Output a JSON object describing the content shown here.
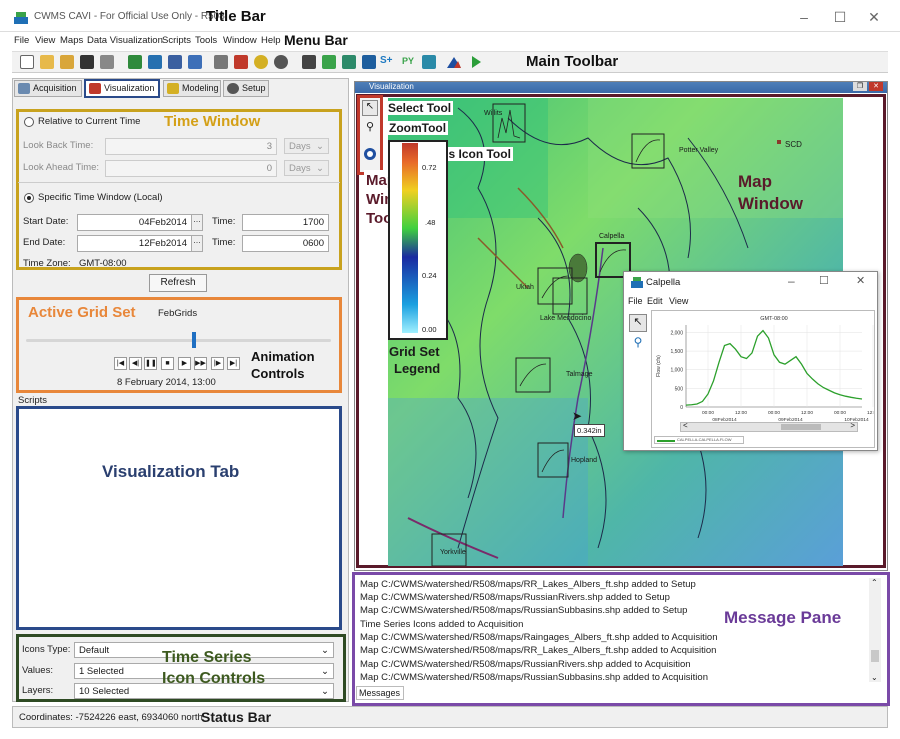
{
  "window": {
    "title": "CWMS CAVI - For Official Use Only - R508",
    "annotation": "Title Bar"
  },
  "menu": {
    "items": [
      "File",
      "View",
      "Maps",
      "Data Visualization",
      "Scripts",
      "Tools",
      "Window",
      "Help"
    ],
    "annotation": "Menu Bar"
  },
  "toolbar": {
    "annotation": "Main Toolbar",
    "icons": [
      "new-icon",
      "open-icon",
      "open-folder-icon",
      "save-icon",
      "print-icon",
      "grid-icon",
      "refresh-icon",
      "window-icon",
      "windows-icon",
      "tools-icon",
      "chart-icon",
      "gear-sun-icon",
      "gear-icon",
      "table-icon",
      "image-icon",
      "map-icon",
      "layers-icon",
      "script-s-icon",
      "python-icon",
      "database-icon",
      "triangle-chart-icon",
      "run-icon"
    ],
    "py_label": "PY",
    "s_label": "S+"
  },
  "tabs": {
    "acquisition": "Acquisition",
    "visualization": "Visualization",
    "modeling": "Modeling",
    "setup": "Setup"
  },
  "time_window": {
    "annotation": "Time Window",
    "relative_label": "Relative to Current Time",
    "look_back_label": "Look Back Time:",
    "look_back_value": "3",
    "look_back_unit": "Days",
    "look_ahead_label": "Look Ahead Time:",
    "look_ahead_value": "0",
    "look_ahead_unit": "Days",
    "specific_label": "Specific Time Window (Local)",
    "start_label": "Start Date:",
    "start_value": "04Feb2014",
    "start_time_label": "Time:",
    "start_time": "1700",
    "end_label": "End Date:",
    "end_value": "12Feb2014",
    "end_time_label": "Time:",
    "end_time": "0600",
    "timezone_label": "Time Zone:",
    "timezone_value": "GMT-08:00",
    "refresh": "Refresh"
  },
  "grid_set": {
    "annotation": "Active Grid Set",
    "name": "FebGrids",
    "animation_annotation_1": "Animation",
    "animation_annotation_2": "Controls",
    "current_time": "8 February 2014, 13:00",
    "slider_position": 0.55
  },
  "scripts": {
    "label": "Scripts",
    "annotation": "Visualization Tab"
  },
  "icon_controls": {
    "annotation_1": "Time Series",
    "annotation_2": "Icon Controls",
    "icons_type_label": "Icons Type:",
    "icons_type_value": "Default",
    "values_label": "Values:",
    "values_value": "1 Selected",
    "layers_label": "Layers:",
    "layers_value": "10 Selected"
  },
  "map": {
    "window_title": "Visualization",
    "annotation_1": "Map",
    "annotation_2": "Window",
    "toolbar_annotation_1": "Map",
    "toolbar_annotation_2": "Window",
    "toolbar_annotation_3": "Toolbar",
    "select_tool": "Select Tool",
    "zoom_tool": "ZoomTool",
    "ts_icon_tool": "Time Series Icon Tool",
    "legend_annotation_1": "Grid Set",
    "legend_annotation_2": "Legend",
    "legend_ticks": [
      "0.72",
      ".48",
      "0.24",
      "0.00"
    ],
    "places": [
      "Willits",
      "Potter Valley",
      "SCD",
      "Calpella",
      "Ukiah",
      "Lake Mendocino",
      "Talmage",
      "Hopland",
      "Yorkville"
    ],
    "measure_label": "0.342in"
  },
  "popup": {
    "title": "Calpella",
    "menu": [
      "File",
      "Edit",
      "View"
    ],
    "chart_header": "GMT-08:00",
    "legend_text": "CALPELLA-CALPELLA.FLOW"
  },
  "chart_data": {
    "type": "line",
    "title": "GMT-08:00",
    "xlabel": "",
    "ylabel": "Flow (cfs)",
    "x_ticks": [
      "00:00",
      "12:00",
      "00:00",
      "12:00",
      "00:00",
      "12:00"
    ],
    "x_date_ticks": [
      "08Feb2014",
      "09Feb2014",
      "10Feb2014"
    ],
    "y_ticks": [
      "0",
      "500",
      "1,000",
      "1,500",
      "2,000"
    ],
    "ylim": [
      0,
      2200
    ],
    "series": [
      {
        "name": "CALPELLA-CALPELLA.FLOW",
        "color": "#2ca02c",
        "x": [
          0,
          2,
          4,
          6,
          8,
          10,
          12,
          14,
          16,
          18,
          20,
          22,
          24,
          26,
          28,
          30,
          32,
          34,
          36,
          38,
          40,
          42,
          44,
          46,
          48,
          50,
          52,
          54,
          56,
          58,
          60,
          62,
          64
        ],
        "values": [
          50,
          60,
          80,
          150,
          350,
          700,
          1200,
          1650,
          1700,
          1550,
          1350,
          1300,
          1450,
          1900,
          2050,
          1850,
          1400,
          1200,
          1150,
          1250,
          1350,
          1150,
          900,
          750,
          620,
          520,
          450,
          380,
          330,
          290,
          260,
          235,
          215
        ]
      }
    ]
  },
  "messages": {
    "annotation": "Message Pane",
    "tab": "Messages",
    "lines": [
      "Map C:/CWMS/watershed/R508/maps/RR_Lakes_Albers_ft.shp added to Setup",
      "Map C:/CWMS/watershed/R508/maps/RussianRivers.shp added to Setup",
      "Map C:/CWMS/watershed/R508/maps/RussianSubbasins.shp added to Setup",
      "Time Series Icons added to Acquisition",
      "Map C:/CWMS/watershed/R508/maps/Raingages_Albers_ft.shp added to Acquisition",
      "Map C:/CWMS/watershed/R508/maps/RR_Lakes_Albers_ft.shp added to Acquisition",
      "Map C:/CWMS/watershed/R508/maps/RussianRivers.shp added to Acquisition",
      "Map C:/CWMS/watershed/R508/maps/RussianSubbasins.shp added to Acquisition"
    ]
  },
  "status": {
    "coordinates": "Coordinates: -7524226 east, 6934060 north",
    "annotation": "Status Bar"
  },
  "colors": {
    "time_window_border": "#c8a21e",
    "grid_set_border": "#e8873a",
    "visualization_tab_border": "#2a4a8a",
    "icon_controls_border": "#2e4a23",
    "map_window_border": "#5a1a2a",
    "map_toolbar_border": "#c0392b",
    "message_pane_border": "#7a4aa8",
    "time_window_text": "#d4a017",
    "grid_set_text": "#e8873a",
    "vis_tab_text": "#2a3f6f",
    "icon_controls_text": "#3d5a1f",
    "map_text": "#5a1a2a",
    "msg_text": "#6a3a98"
  }
}
